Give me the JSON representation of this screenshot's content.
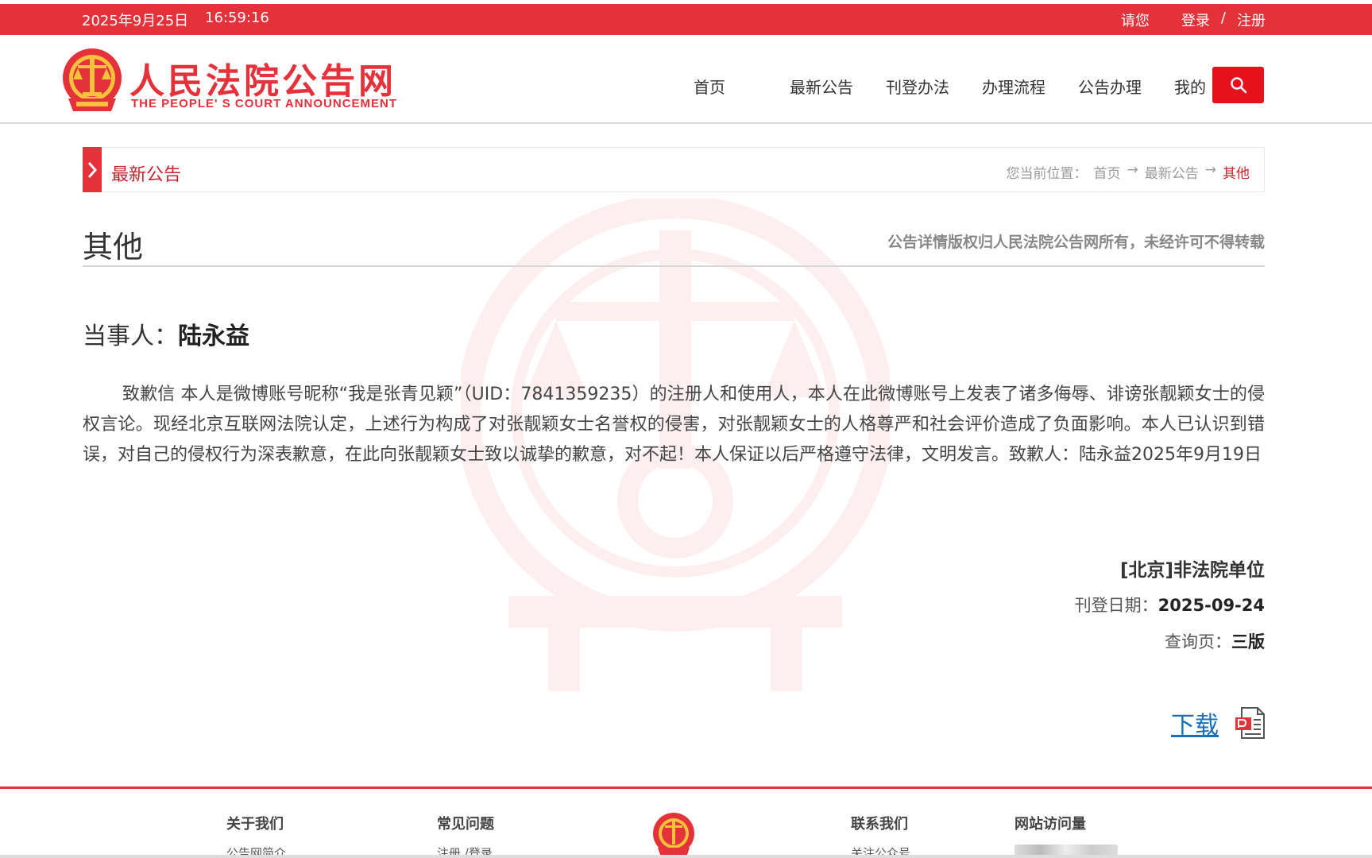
{
  "topbar": {
    "date": "2025年9月25日",
    "time": "16:59:16",
    "greeting": "请您",
    "login": "登录",
    "separator": "/",
    "register": "注册"
  },
  "header": {
    "logo_cn": "人民法院公告网",
    "logo_en": "THE PEOPLE' S COURT ANNOUNCEMENT",
    "nav": [
      "首页",
      "最新公告",
      "刊登办法",
      "办理流程",
      "公告办理",
      "我的"
    ],
    "search_icon": "search-icon"
  },
  "crumbbar": {
    "title": "最新公告",
    "prefix": "您当前位置：",
    "home": "首页",
    "arrow1": "→",
    "level1": "最新公告",
    "arrow2": "→",
    "current": "其他"
  },
  "notice": {
    "category": "其他",
    "copyright": "公告详情版权归人民法院公告网所有，未经许可不得转载",
    "party_label": "当事人：",
    "party_name": "陆永益",
    "body": "致歉信 本人是微博账号昵称“我是张青见颖”（UID：7841359235）的注册人和使用人，本人在此微博账号上发表了诸多侮辱、诽谤张靓颖女士的侵权言论。现经北京互联网法院认定，上述行为构成了对张靓颖女士名誉权的侵害，对张靓颖女士的人格尊严和社会评价造成了负面影响。本人已认识到错误，对自己的侵权行为深表歉意，在此向张靓颖女士致以诚挚的歉意，对不起！本人保证以后严格遵守法律，文明发言。致歉人：陆永益2025年9月19日",
    "publisher": "[北京]非法院单位",
    "date_label": "刊登日期：",
    "date_value": "2025-09-24",
    "page_label": "查询页：",
    "page_value": "三版",
    "download": "下载"
  },
  "footer": {
    "about": "关于我们",
    "about_item": "公告网简介",
    "faq": "常见问题",
    "faq_item": "注册 /登录",
    "contact": "联系我们",
    "contact_item": "关注公众号",
    "visits": "网站访问量"
  },
  "colors": {
    "accent": "#e5323a",
    "link": "#1a6fb5"
  }
}
